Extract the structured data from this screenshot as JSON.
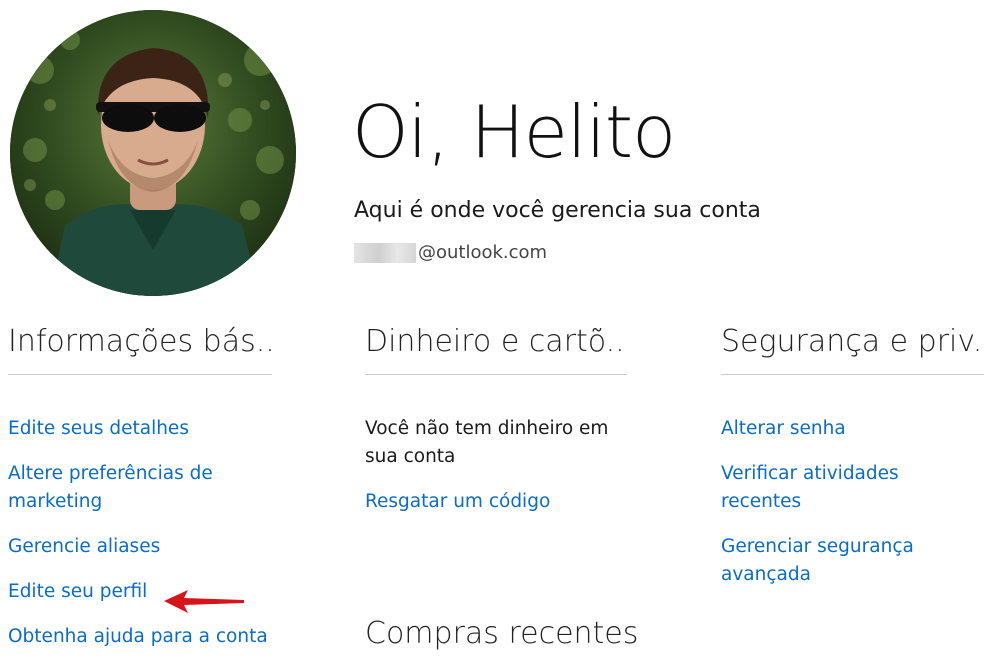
{
  "header": {
    "greeting": "Oi, Helito",
    "subtitle": "Aqui é onde você gerencia sua conta",
    "email_domain": "@outlook.com"
  },
  "columns": {
    "basic_info": {
      "title": "Informações bás...",
      "links": [
        "Edite seus detalhes",
        "Altere preferências de marketing",
        "Gerencie aliases",
        "Edite seu perfil",
        "Obtenha ajuda para a conta"
      ]
    },
    "money": {
      "title": "Dinheiro e cartõ...",
      "balance_text": "Você não tem dinheiro em sua conta",
      "redeem_link": "Resgatar um código",
      "recent_purchases_title": "Compras recentes"
    },
    "security": {
      "title": "Segurança e priv...",
      "links": [
        "Alterar senha",
        "Verificar atividades recentes",
        "Gerenciar segurança avançada"
      ]
    }
  },
  "colors": {
    "link": "#0a6cc5",
    "text": "#1a1a1a",
    "divider": "#c8c8c8",
    "annotation_arrow": "#d7141a"
  },
  "icons": {
    "avatar": "profile-photo",
    "annotation": "red-arrow-pointing-left"
  }
}
